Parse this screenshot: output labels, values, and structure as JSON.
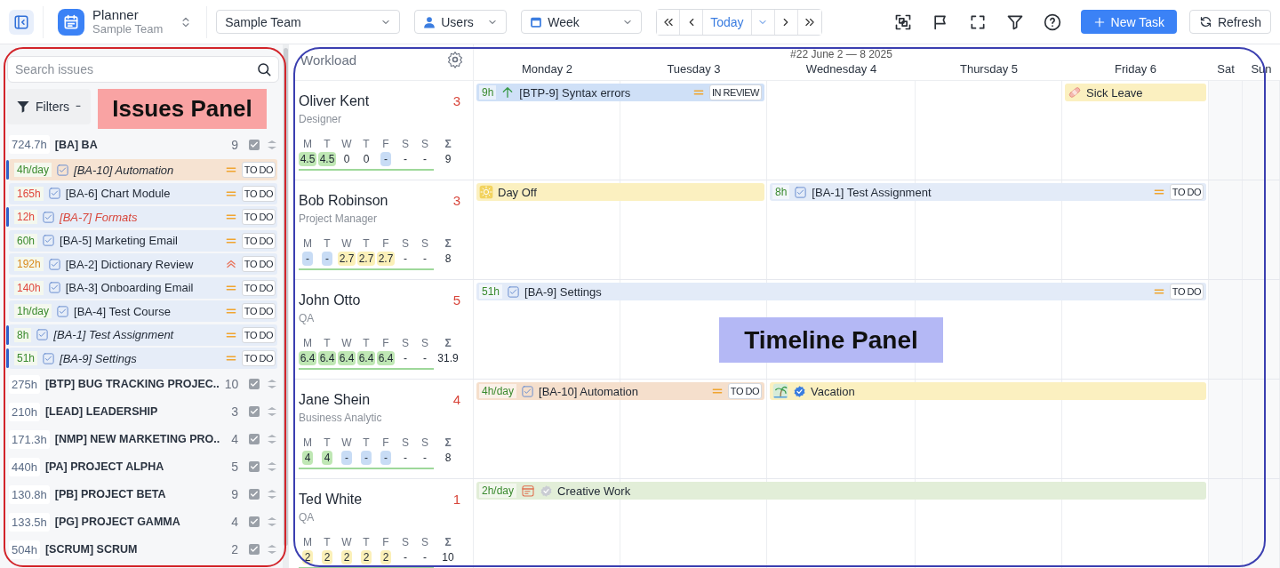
{
  "toolbar": {
    "app": {
      "title": "Planner",
      "subtitle": "Sample Team"
    },
    "team_select": {
      "value": "Sample Team"
    },
    "group_select": {
      "value": "Users"
    },
    "range_select": {
      "value": "Week"
    },
    "nav": {
      "today": "Today"
    },
    "new_task": "New Task",
    "refresh": "Refresh"
  },
  "issues": {
    "search": {
      "placeholder": "Search issues"
    },
    "filters": {
      "label": "Filters"
    },
    "groups": [
      {
        "hours": "724.7h",
        "name": "[BA] BA",
        "count": "9",
        "children": [
          {
            "hours": "4h/day",
            "color": "#3a8a2e",
            "title": "[BA-10] Automation",
            "scheduled": true,
            "overdue": false,
            "highlighted": true,
            "high_priority": false,
            "status": "TO DO"
          },
          {
            "hours": "165h",
            "color": "#e0463c",
            "title": "[BA-6] Chart Module",
            "scheduled": false,
            "overdue": false,
            "highlighted": false,
            "high_priority": false,
            "status": "TO DO"
          },
          {
            "hours": "12h",
            "color": "#e0463c",
            "title": "[BA-7] Formats",
            "scheduled": true,
            "overdue": true,
            "highlighted": false,
            "high_priority": false,
            "status": "TO DO"
          },
          {
            "hours": "60h",
            "color": "#3a8a2e",
            "title": "[BA-5] Marketing Email",
            "scheduled": false,
            "overdue": false,
            "highlighted": false,
            "high_priority": false,
            "status": "TO DO"
          },
          {
            "hours": "192h",
            "color": "#d98a1c",
            "title": "[BA-2] Dictionary Review",
            "scheduled": false,
            "overdue": false,
            "highlighted": false,
            "high_priority": true,
            "status": "TO DO"
          },
          {
            "hours": "140h",
            "color": "#e0463c",
            "title": "[BA-3] Onboarding Email",
            "scheduled": false,
            "overdue": false,
            "highlighted": false,
            "high_priority": false,
            "status": "TO DO"
          },
          {
            "hours": "1h/day",
            "color": "#3a8a2e",
            "title": "[BA-4] Test Course",
            "scheduled": false,
            "overdue": false,
            "highlighted": false,
            "high_priority": false,
            "status": "TO DO"
          },
          {
            "hours": "8h",
            "color": "#3a8a2e",
            "title": "[BA-1] Test Assignment",
            "scheduled": true,
            "overdue": false,
            "highlighted": false,
            "high_priority": false,
            "status": "TO DO"
          },
          {
            "hours": "51h",
            "color": "#3a8a2e",
            "title": "[BA-9] Settings",
            "scheduled": true,
            "overdue": false,
            "highlighted": false,
            "high_priority": false,
            "status": "TO DO"
          }
        ]
      },
      {
        "hours": "275h",
        "name": "[BTP] BUG TRACKING PROJEC..",
        "count": "10"
      },
      {
        "hours": "210h",
        "name": "[LEAD] LEADERSHIP",
        "count": "3"
      },
      {
        "hours": "171.3h",
        "name": "[NMP] NEW MARKETING PRO..",
        "count": "4"
      },
      {
        "hours": "440h",
        "name": "[PA] PROJECT ALPHA",
        "count": "5"
      },
      {
        "hours": "130.8h",
        "name": "[PB] PROJECT BETA",
        "count": "9"
      },
      {
        "hours": "133.5h",
        "name": "[PG] PROJECT GAMMA",
        "count": "4"
      },
      {
        "hours": "504h",
        "name": "[SCRUM] SCRUM",
        "count": "2"
      }
    ]
  },
  "timeline": {
    "title": "Workload",
    "week_label": "#22 June 2 — 8 2025",
    "days": [
      {
        "label": "Monday 2"
      },
      {
        "label": "Tuesday 3"
      },
      {
        "label": "Wednesday 4"
      },
      {
        "label": "Thursday 5"
      },
      {
        "label": "Friday 6"
      },
      {
        "label": "Sat"
      },
      {
        "label": "Sun"
      }
    ],
    "people": [
      {
        "name": "Oliver Kent",
        "role": "Designer",
        "count": "3",
        "sum_label": "Σ",
        "total": "9",
        "stats": [
          {
            "day": "M",
            "value": "4.5",
            "kind": "ok"
          },
          {
            "day": "T",
            "value": "4.5",
            "kind": "ok"
          },
          {
            "day": "W",
            "value": "0",
            "kind": "none"
          },
          {
            "day": "T",
            "value": "0",
            "kind": "none"
          },
          {
            "day": "F",
            "value": "-",
            "kind": "off"
          },
          {
            "day": "S",
            "value": "-",
            "kind": "none"
          },
          {
            "day": "S",
            "value": "-",
            "kind": "none"
          }
        ],
        "events": [
          {
            "kind": "story",
            "hours": "9h",
            "title": "[BTP-9] Syntax errors",
            "status": "IN REVIEW",
            "color": "#cfe0f7"
          },
          {
            "kind": "sick-leave",
            "title": "Sick Leave",
            "color": "#fbf0c0"
          }
        ]
      },
      {
        "name": "Bob Robinson",
        "role": "Project Manager",
        "count": "3",
        "sum_label": "Σ",
        "total": "8",
        "stats": [
          {
            "day": "M",
            "value": "-",
            "kind": "off"
          },
          {
            "day": "T",
            "value": "-",
            "kind": "off"
          },
          {
            "day": "W",
            "value": "2.7",
            "kind": "under"
          },
          {
            "day": "T",
            "value": "2.7",
            "kind": "under"
          },
          {
            "day": "F",
            "value": "2.7",
            "kind": "under"
          },
          {
            "day": "S",
            "value": "-",
            "kind": "none"
          },
          {
            "day": "S",
            "value": "-",
            "kind": "none"
          }
        ],
        "events": [
          {
            "kind": "day-off",
            "title": "Day Off",
            "color": "#fbf0c0"
          },
          {
            "kind": "task",
            "hours": "8h",
            "title": "[BA-1] Test Assignment",
            "status": "TO DO",
            "color": "#e3ebf8"
          }
        ]
      },
      {
        "name": "John Otto",
        "role": "QA",
        "count": "5",
        "sum_label": "Σ",
        "total": "31.9",
        "stats": [
          {
            "day": "M",
            "value": "6.4",
            "kind": "ok"
          },
          {
            "day": "T",
            "value": "6.4",
            "kind": "ok"
          },
          {
            "day": "W",
            "value": "6.4",
            "kind": "ok"
          },
          {
            "day": "T",
            "value": "6.4",
            "kind": "ok"
          },
          {
            "day": "F",
            "value": "6.4",
            "kind": "ok"
          },
          {
            "day": "S",
            "value": "-",
            "kind": "none"
          },
          {
            "day": "S",
            "value": "-",
            "kind": "none"
          }
        ],
        "events": [
          {
            "kind": "task",
            "hours": "51h",
            "title": "[BA-9] Settings",
            "status": "TO DO",
            "color": "#e3ebf8"
          }
        ]
      },
      {
        "name": "Jane Shein",
        "role": "Business Analytic",
        "count": "4",
        "sum_label": "Σ",
        "total": "8",
        "stats": [
          {
            "day": "M",
            "value": "4",
            "kind": "ok"
          },
          {
            "day": "T",
            "value": "4",
            "kind": "ok"
          },
          {
            "day": "W",
            "value": "-",
            "kind": "off"
          },
          {
            "day": "T",
            "value": "-",
            "kind": "off"
          },
          {
            "day": "F",
            "value": "-",
            "kind": "off"
          },
          {
            "day": "S",
            "value": "-",
            "kind": "none"
          },
          {
            "day": "S",
            "value": "-",
            "kind": "none"
          }
        ],
        "events": [
          {
            "kind": "task",
            "hours": "4h/day",
            "title": "[BA-10] Automation",
            "status": "TO DO",
            "color": "#f5dfcc"
          },
          {
            "kind": "vacation",
            "title": "Vacation",
            "color": "#fbf0c0"
          }
        ]
      },
      {
        "name": "Ted White",
        "role": "QA",
        "count": "1",
        "sum_label": "Σ",
        "total": "10",
        "stats": [
          {
            "day": "M",
            "value": "2",
            "kind": "under"
          },
          {
            "day": "T",
            "value": "2",
            "kind": "under"
          },
          {
            "day": "W",
            "value": "2",
            "kind": "under"
          },
          {
            "day": "T",
            "value": "2",
            "kind": "under"
          },
          {
            "day": "F",
            "value": "2",
            "kind": "under"
          },
          {
            "day": "S",
            "value": "-",
            "kind": "none"
          },
          {
            "day": "S",
            "value": "-",
            "kind": "none"
          }
        ],
        "events": [
          {
            "kind": "work",
            "hours": "2h/day",
            "title": "Creative Work",
            "color": "#e2eed8"
          }
        ]
      }
    ]
  },
  "annotations": [
    {
      "label": "Issues Panel",
      "color": "#d2242a"
    },
    {
      "label": "Timeline Panel",
      "color": "#3b3fb0"
    }
  ]
}
